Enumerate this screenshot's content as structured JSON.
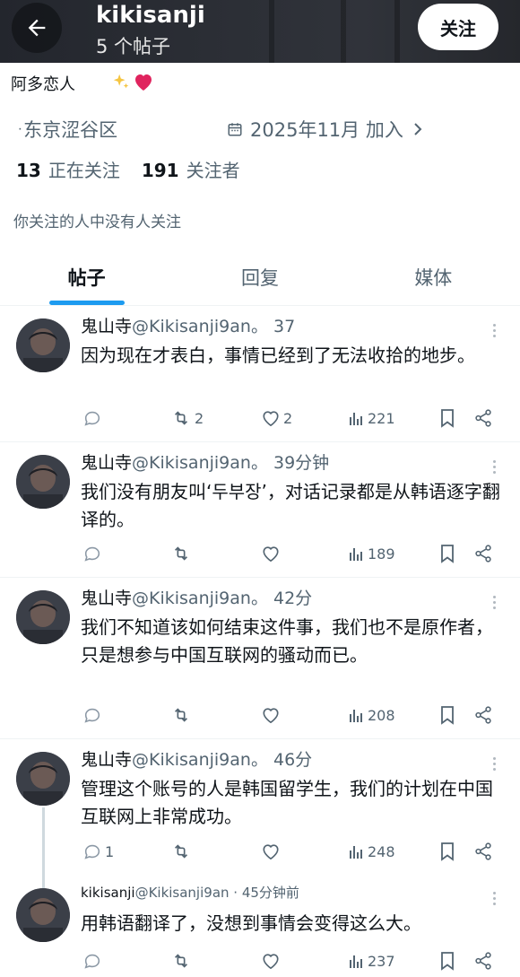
{
  "header": {
    "username": "kikisanji",
    "post_count": "5 个帖子",
    "follow_label": "关注"
  },
  "profile": {
    "bio": "阿多恋人",
    "location": "东京涩谷区",
    "joined": "2025年11月 加入",
    "following_count": "13",
    "following_label": "正在关注",
    "followers_count": "191",
    "followers_label": "关注者",
    "mutual_note": "你关注的人中没有人关注"
  },
  "tabs": [
    {
      "label": "帖子"
    },
    {
      "label": "回复"
    },
    {
      "label": "媒体"
    }
  ],
  "posts": [
    {
      "name": "鬼山寺",
      "handle": "@Kikisanji9an。",
      "time": "37",
      "text": "因为现在才表白，事情已经到了无法收拾的地步。",
      "reply_count": "",
      "repost_count": "2",
      "like_count": "2",
      "view_count": "221"
    },
    {
      "name": "鬼山寺",
      "handle": "@Kikisanji9an。",
      "time": "39分钟",
      "text": "我们没有朋友叫‘두부장’，对话记录都是从韩语逐字翻译的。",
      "reply_count": "",
      "repost_count": "",
      "like_count": "",
      "view_count": "189"
    },
    {
      "name": "鬼山寺",
      "handle": "@Kikisanji9an。",
      "time": "42分",
      "text": "我们不知道该如何结束这件事，我们也不是原作者，只是想参与中国互联网的骚动而已。",
      "reply_count": "",
      "repost_count": "",
      "like_count": "",
      "view_count": "208"
    },
    {
      "name": "鬼山寺",
      "handle": "@Kikisanji9an。",
      "time": "46分",
      "text": "管理这个账号的人是韩国留学生，我们的计划在中国互联网上非常成功。",
      "reply_count": "1",
      "repost_count": "",
      "like_count": "",
      "view_count": "248"
    },
    {
      "name": "kikisanji",
      "handle": "@Kikisanji9an",
      "time": "· 45分钟前",
      "text": "用韩语翻译了，没想到事情会变得这么大。",
      "reply_count": "",
      "repost_count": "",
      "like_count": "",
      "view_count": "237"
    }
  ],
  "colors": {
    "accent": "#1d9bf0",
    "text": "#0f1419",
    "muted": "#536471",
    "heart": "#e0245e"
  }
}
